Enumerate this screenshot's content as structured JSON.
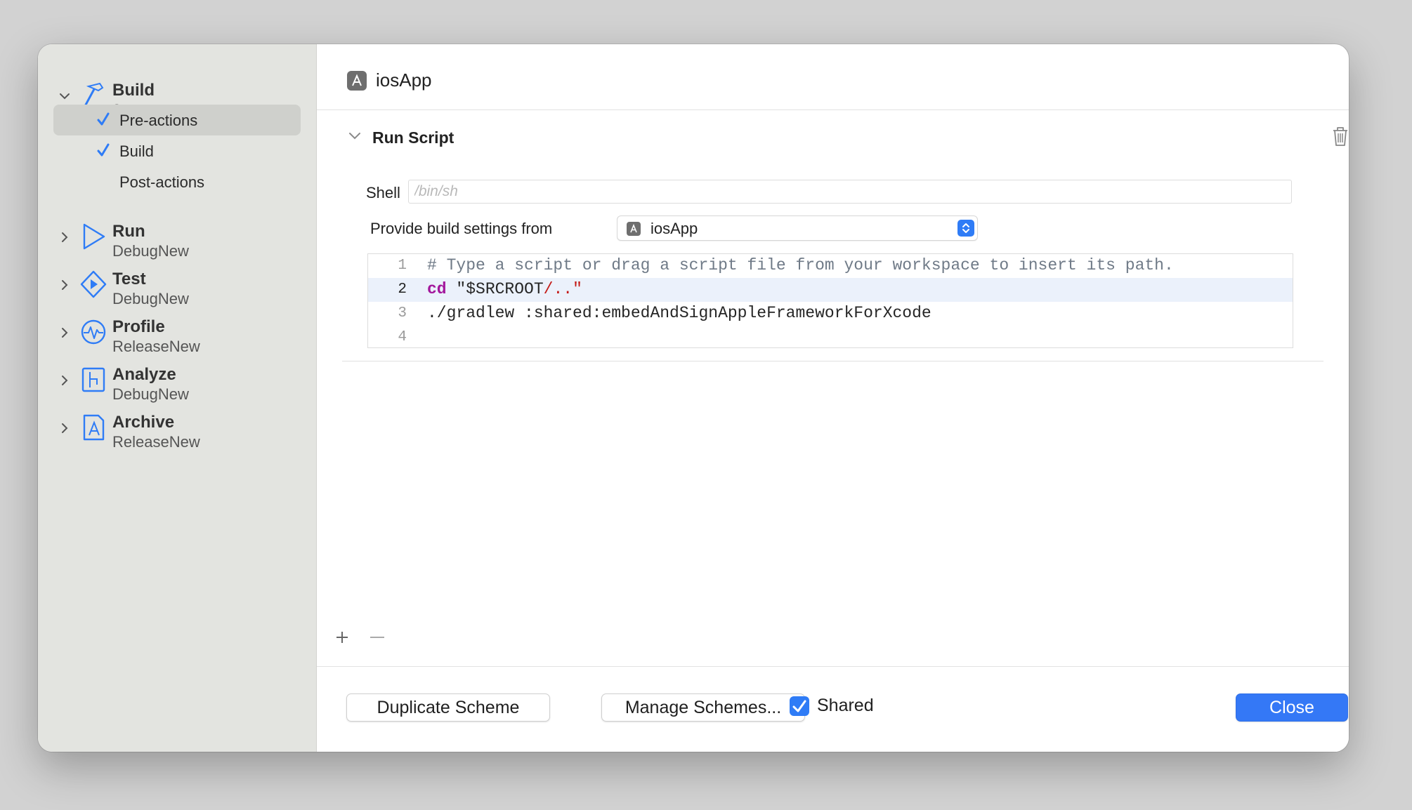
{
  "sidebar": {
    "groups": [
      {
        "title": "Build",
        "subtitle": "2 targets",
        "icon": "hammer-icon",
        "expanded": true
      },
      {
        "title": "Run",
        "subtitle": "DebugNew",
        "icon": "play-icon",
        "expanded": false
      },
      {
        "title": "Test",
        "subtitle": "DebugNew",
        "icon": "test-diamond-icon",
        "expanded": false
      },
      {
        "title": "Profile",
        "subtitle": "ReleaseNew",
        "icon": "profile-waveform-icon",
        "expanded": false
      },
      {
        "title": "Analyze",
        "subtitle": "DebugNew",
        "icon": "analyze-icon",
        "expanded": false
      },
      {
        "title": "Archive",
        "subtitle": "ReleaseNew",
        "icon": "archive-appstore-icon",
        "expanded": false
      }
    ],
    "build_items": [
      {
        "label": "Pre-actions",
        "checked": true,
        "selected": true
      },
      {
        "label": "Build",
        "checked": true,
        "selected": false
      },
      {
        "label": "Post-actions",
        "checked": false,
        "selected": false
      }
    ]
  },
  "main": {
    "header_title": "iosApp",
    "section_title": "Run Script",
    "shell_label": "Shell",
    "shell_placeholder": "/bin/sh",
    "shell_value": "",
    "provide_label": "Provide build settings from",
    "provide_value": "iosApp",
    "code_lines": [
      {
        "num": "1",
        "text": "# Type a script or drag a script file from your workspace to insert its path."
      },
      {
        "num": "2",
        "kw": "cd",
        "str_open": "\"$SRCROOT",
        "str_path": "/..",
        "str_close": "\""
      },
      {
        "num": "3",
        "text": "./gradlew :shared:embedAndSignAppleFrameworkForXcode"
      },
      {
        "num": "4",
        "text": ""
      }
    ]
  },
  "footer": {
    "duplicate_label": "Duplicate Scheme",
    "manage_label": "Manage Schemes...",
    "shared_label": "Shared",
    "shared_checked": true,
    "close_label": "Close"
  },
  "colors": {
    "accent": "#3478f6",
    "sidebar_bg": "#e3e4e0",
    "selected_bg": "#cfd0cc",
    "keyword": "#a3179c",
    "string": "#c41a16",
    "comment": "#6f7a87"
  }
}
